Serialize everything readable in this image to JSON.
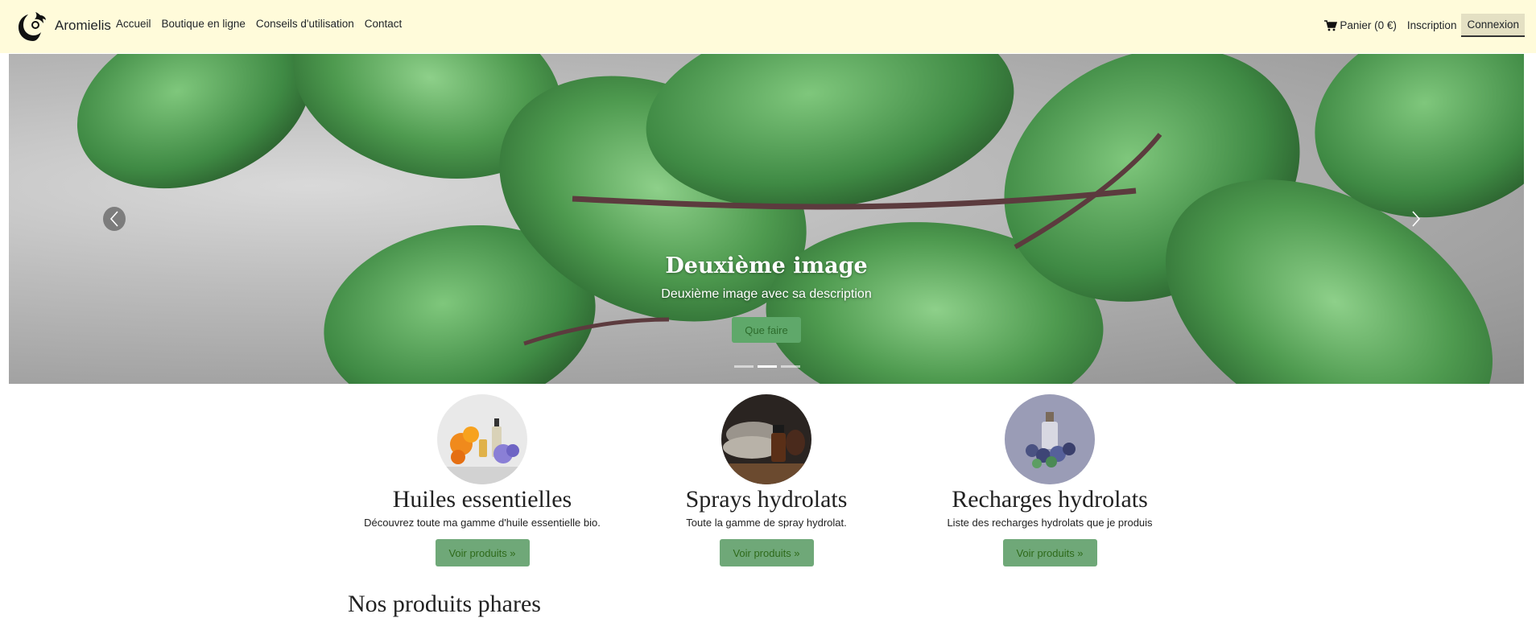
{
  "navbar": {
    "brand": "Aromielis",
    "links": [
      "Accueil",
      "Boutique en ligne",
      "Conseils d'utilisation",
      "Contact"
    ],
    "cart_label": "Panier (0 €)",
    "signup_label": "Inscription",
    "login_label": "Connexion",
    "background": "#fffbda"
  },
  "carousel": {
    "title": "Deuxième image",
    "description": "Deuxième image avec sa description",
    "button_label": "Que faire",
    "slides_count": 3,
    "active_slide": 2
  },
  "categories": [
    {
      "title": "Huiles essentielles",
      "description": "Découvrez toute ma gamme d'huile essentielle bio.",
      "button_label": "Voir produits »"
    },
    {
      "title": "Sprays hydrolats",
      "description": "Toute la gamme de spray hydrolat.",
      "button_label": "Voir produits »"
    },
    {
      "title": "Recharges hydrolats",
      "description": "Liste des recharges hydrolats que je produis",
      "button_label": "Voir produits »"
    }
  ],
  "featured_title": "Nos produits phares",
  "colors": {
    "accent_green": "#6fa878",
    "nav_bg": "#fffbda"
  }
}
